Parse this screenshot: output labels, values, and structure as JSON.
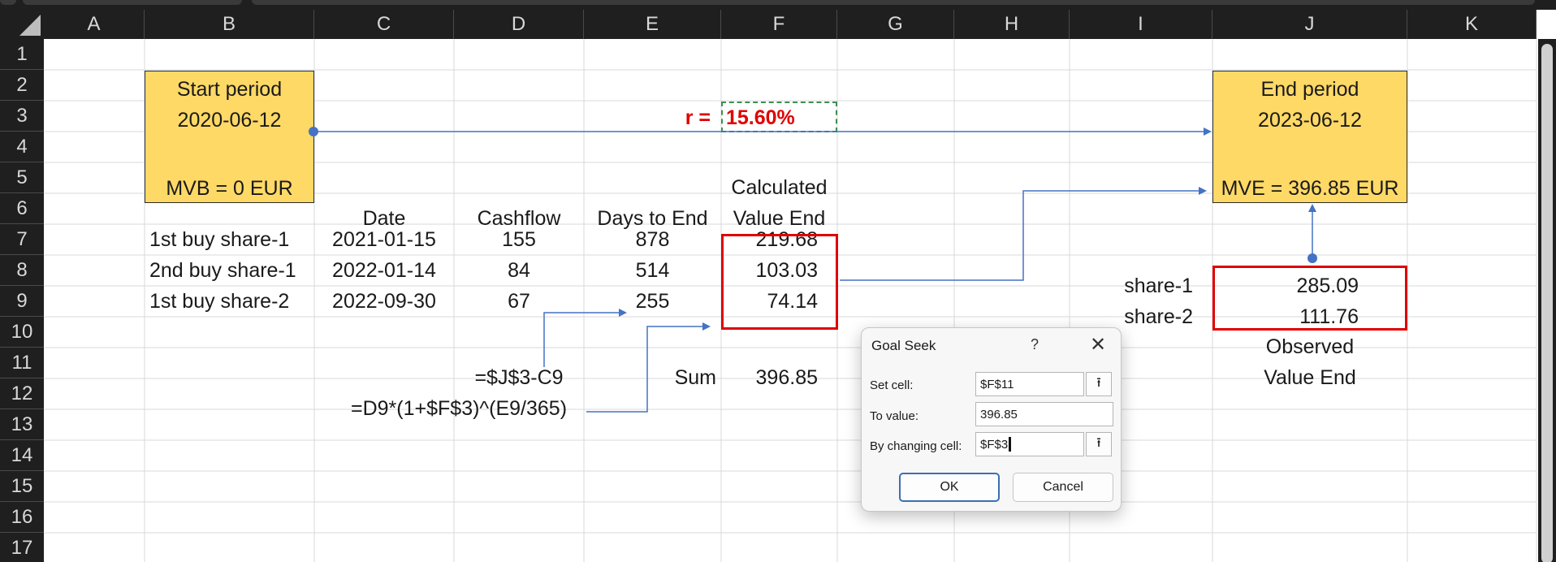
{
  "columns": [
    "A",
    "B",
    "C",
    "D",
    "E",
    "F",
    "G",
    "H",
    "I",
    "J",
    "K"
  ],
  "rows": [
    "1",
    "2",
    "3",
    "4",
    "5",
    "6",
    "7",
    "8",
    "9",
    "10",
    "11",
    "12",
    "13",
    "14",
    "15",
    "16",
    "17"
  ],
  "start_box": {
    "line1": "Start period",
    "line2": "2020-06-12",
    "line3": "MVB = 0 EUR"
  },
  "end_box": {
    "line1": "End period",
    "line2": "2023-06-12",
    "line3": "MVE = 396.85 EUR"
  },
  "rate": {
    "label": "r =",
    "value": "15.60%"
  },
  "headers": {
    "calculated": "Calculated",
    "value_end": "Value End",
    "date": "Date",
    "cashflow": "Cashflow",
    "days_to_end": "Days to End"
  },
  "table": [
    {
      "name": "1st buy share-1",
      "date": "2021-01-15",
      "cashflow": "155",
      "days": "878",
      "value_end": "219.68"
    },
    {
      "name": "2nd buy share-1",
      "date": "2022-01-14",
      "cashflow": "84",
      "days": "514",
      "value_end": "103.03"
    },
    {
      "name": "1st buy share-2",
      "date": "2022-09-30",
      "cashflow": "67",
      "days": "255",
      "value_end": "74.14"
    }
  ],
  "observed": [
    {
      "name": "share-1",
      "value": "285.09"
    },
    {
      "name": "share-2",
      "value": "111.76"
    }
  ],
  "observed_label": {
    "line1": "Observed",
    "line2": "Value End"
  },
  "formula_days": "=$J$3-C9",
  "formula_value": "=D9*(1+$F$3)^(E9/365)",
  "sum": {
    "label": "Sum",
    "value": "396.85"
  },
  "dialog": {
    "title": "Goal Seek",
    "help": "?",
    "close": "✕",
    "set_cell_label": "Set cell:",
    "set_cell_value": "$F$11",
    "to_value_label": "To value:",
    "to_value_value": "396.85",
    "changing_cell_label": "By changing cell:",
    "changing_cell_value": "$F$3",
    "ok": "OK",
    "cancel": "Cancel"
  },
  "colors": {
    "yellow": "#ffd966",
    "red": "#e00000",
    "arrow": "#4472c4",
    "header_bg": "#1f1f1f",
    "grid": "#d9d9d9"
  }
}
